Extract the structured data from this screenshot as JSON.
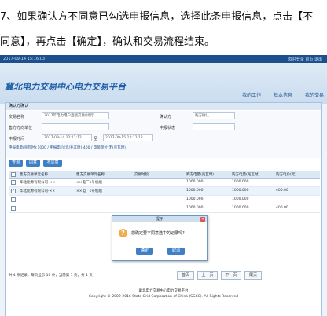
{
  "instruction": {
    "line1": "7、如果确认方不同意已勾选申报信息，选择此条申报信息，点击【不",
    "line2": "同意】，再点击【确定】，确认和交易流程结束。"
  },
  "app": {
    "datetime": "2017-09-14 15:16:03",
    "topbar_right": "欢迎登录   首页   退出",
    "title": "冀北电力交易中心电力交易平台",
    "nav": [
      "我的工作",
      "基本信息",
      "我的交易"
    ]
  },
  "panel": {
    "title": "确认方确认",
    "form": {
      "label1": "交易名称",
      "value1": "2017年电力用户直接交易(试行)",
      "label2": "确认方",
      "value2": "购方确认",
      "label3": "售方方向单位",
      "value3": "",
      "label4": "申报状态",
      "value4": "",
      "label5": "申报时间",
      "value5_from": "2017-09-14 12:12:12",
      "value5_sep": "至",
      "value5_to": "2017-09-15 12:12:12",
      "info": "申报电量(兆瓦时):1000 / 申报电价(元/兆瓦时):400 / 电能单位:无(兆瓦时)"
    },
    "buttons": [
      "查询",
      "同意",
      "不同意"
    ],
    "columns": [
      "售方交易单元名称",
      "售方交易单元名称",
      "交易时段",
      "购方电量(兆瓦时)",
      "购方电量(兆瓦时)",
      "购方电价(元)"
    ],
    "rows": [
      {
        "checked": false,
        "c1": "华北能源有限公司-××",
        "c2": "××电厂1号机组",
        "c3": "",
        "c4": "1000.000",
        "c5": "1000.000",
        "c6": ""
      },
      {
        "checked": true,
        "c1": "华北能源有限公司-××",
        "c2": "××电厂1号机组",
        "c3": "",
        "c4": "1000.000",
        "c5": "1000.000",
        "c6": "400.00"
      },
      {
        "checked": false,
        "c1": "",
        "c2": "",
        "c3": "",
        "c4": "1000.000",
        "c5": "1000.000",
        "c6": ""
      },
      {
        "checked": false,
        "c1": "",
        "c2": "",
        "c3": "",
        "c4": "1000.000",
        "c5": "1000.000",
        "c6": "400.00"
      }
    ],
    "pager": {
      "info": "共 4 条记录，每页显示 10 条，当前第 1 页，共 1 页",
      "first": "首页",
      "prev": "上一页",
      "next": "下一页",
      "last": "尾页"
    }
  },
  "footer": {
    "line1": "冀北电力交易中心电力交易平台",
    "line2": "Copyright © 2009-2016 State Grid Corporation of China (SGCC). All Rights Reserved"
  },
  "modal": {
    "title": "提示",
    "message": "您确定要不同意选中的记录吗?",
    "ok": "确定",
    "cancel": "取消"
  }
}
